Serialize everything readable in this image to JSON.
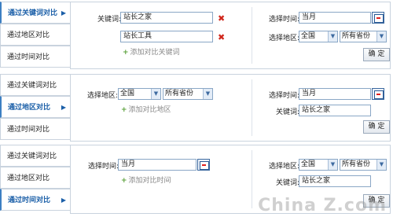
{
  "tabs": {
    "keyword": "通过关键词对比",
    "region": "通过地区对比",
    "time": "通过时间对比"
  },
  "labels": {
    "keyword": "关键词:",
    "select_time": "选择时间:",
    "select_region": "选择地区:"
  },
  "panel1": {
    "keyword_1": "站长之家",
    "keyword_2": "站长工具",
    "add_keyword": "添加对比关键词",
    "time": "当月",
    "region": "全国",
    "province": "所有省份",
    "confirm": "确 定"
  },
  "panel2": {
    "region": "全国",
    "province": "所有省份",
    "add_region": "添加对比地区",
    "time": "当月",
    "keyword": "站长之家",
    "confirm": "确 定"
  },
  "panel3": {
    "time": "当月",
    "add_time": "添加对比时间",
    "region": "全国",
    "province": "所有省份",
    "keyword": "站长之家",
    "confirm": "确 定"
  },
  "watermark": "China Z.com",
  "icons": {
    "tab_arrow": "arrow-right-icon",
    "remove": "remove-x-icon",
    "add": "plus-icon",
    "calendar": "calendar-icon",
    "dropdown": "chevron-down-icon"
  },
  "colors": {
    "active_tab": "#1b5fa8",
    "border": "#c9d3de",
    "remove": "#d0271c",
    "add": "#5aa13a"
  }
}
